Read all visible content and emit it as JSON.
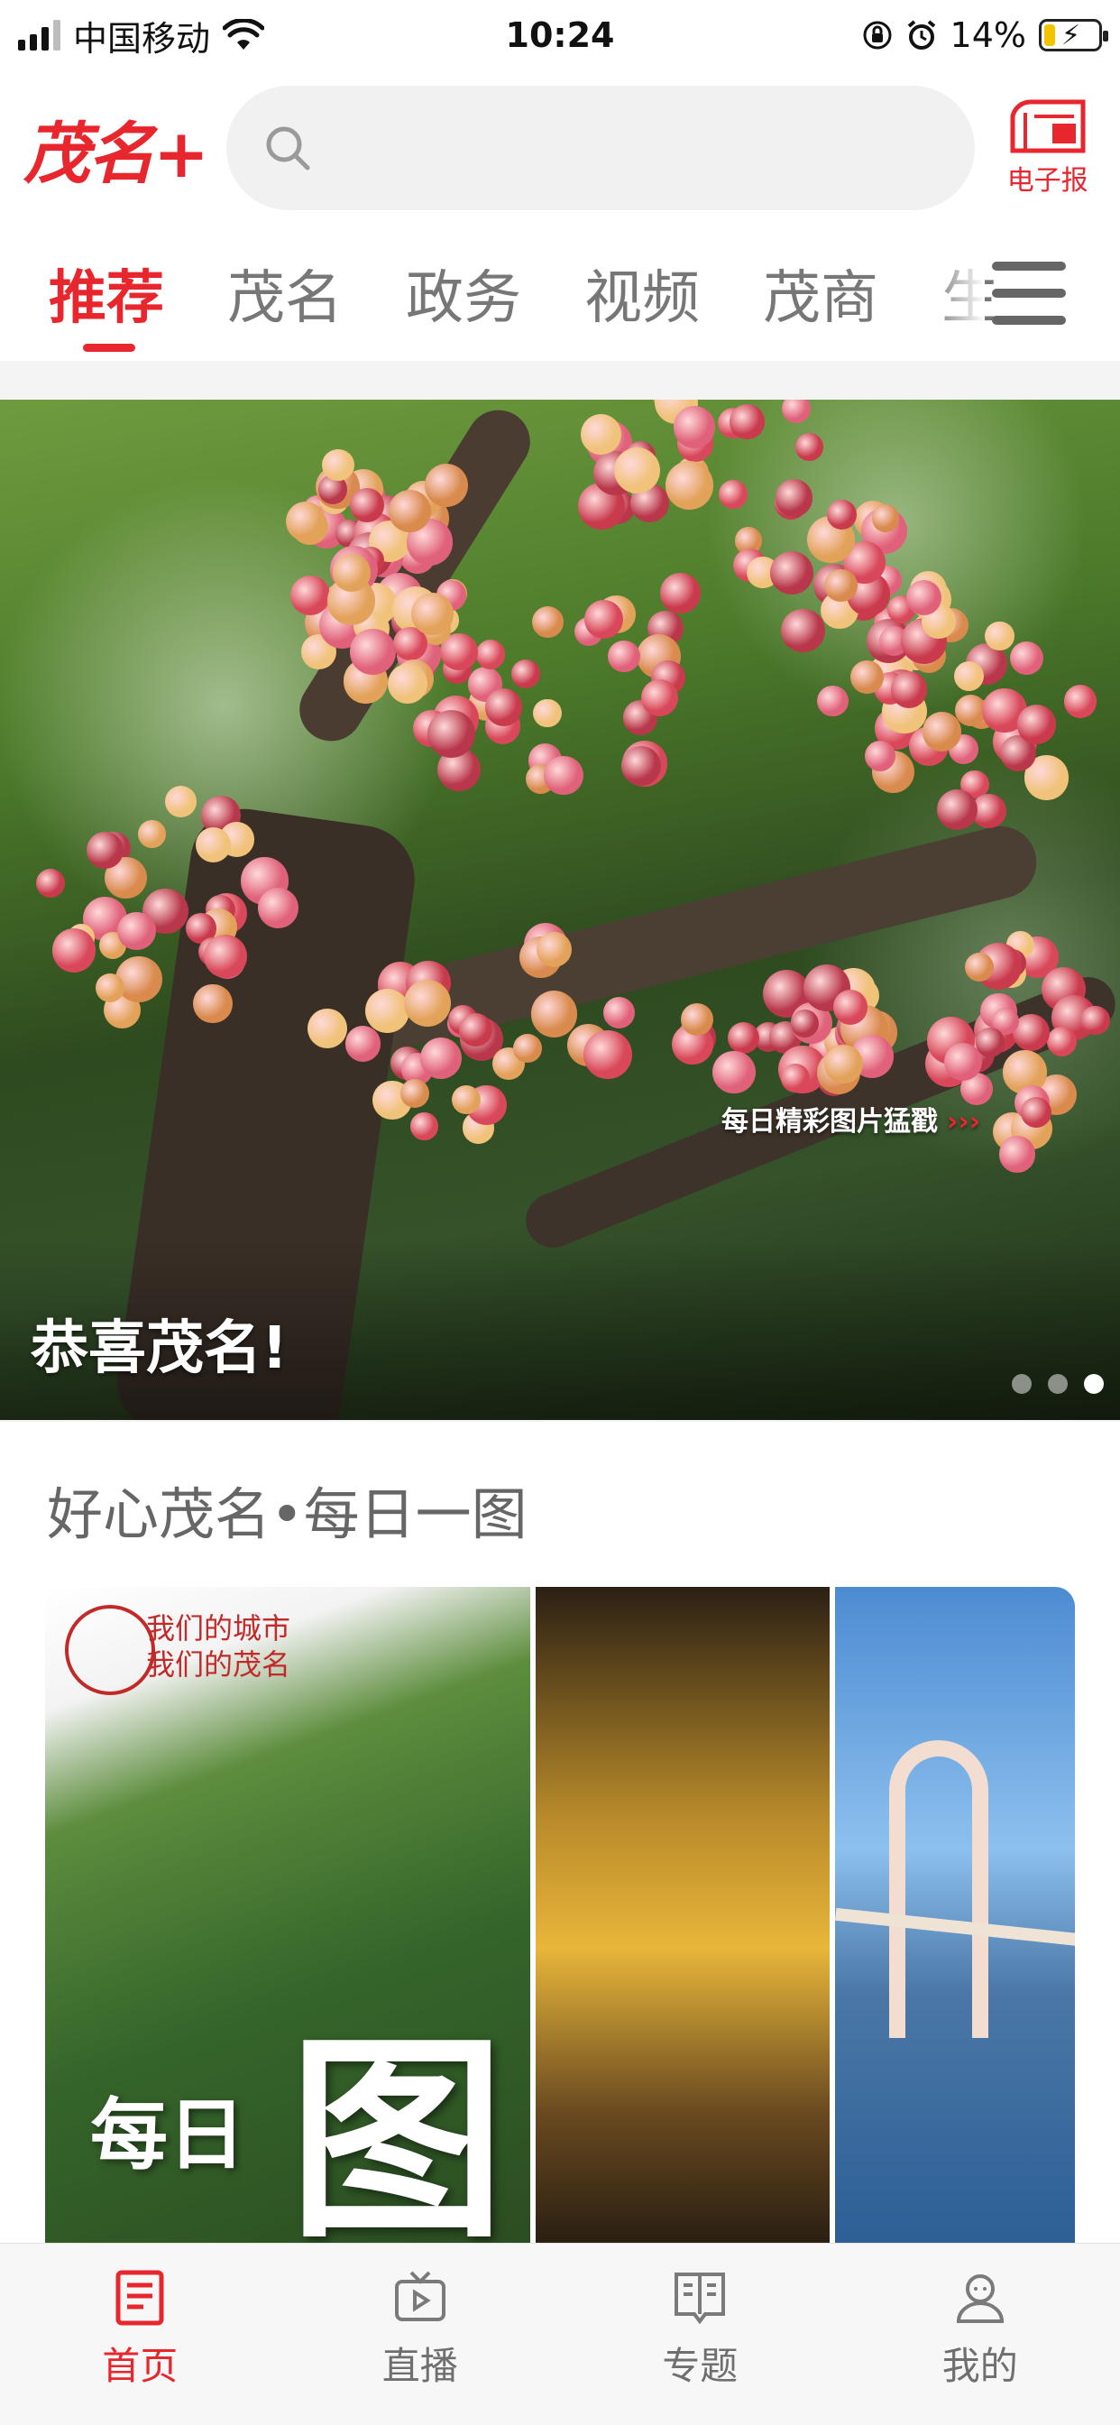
{
  "status_bar": {
    "carrier": "中国移动",
    "time": "10:24",
    "battery": "14%"
  },
  "header": {
    "logo": "茂名+",
    "search_placeholder": "",
    "epaper_label": "电子报"
  },
  "tabs": [
    {
      "label": "推荐",
      "active": true
    },
    {
      "label": "茂名",
      "active": false
    },
    {
      "label": "政务",
      "active": false
    },
    {
      "label": "视频",
      "active": false
    },
    {
      "label": "茂商",
      "active": false
    },
    {
      "label": "生",
      "active": false
    }
  ],
  "banner": {
    "caption": "恭喜茂名!",
    "slide_index": 3,
    "slide_count": 3
  },
  "daily_section": {
    "title": "好心茂名•每日一图",
    "image_slogan": "我们的城市\n我们的茂名",
    "image_big_char": "图",
    "image_small_chars": "每日",
    "image_footer": "每日精彩图片猛戳"
  },
  "bottom_nav": [
    {
      "label": "首页",
      "icon": "home-news-icon",
      "active": true
    },
    {
      "label": "直播",
      "icon": "tv-icon",
      "active": false
    },
    {
      "label": "专题",
      "icon": "book-icon",
      "active": false
    },
    {
      "label": "我的",
      "icon": "user-icon",
      "active": false
    }
  ],
  "colors": {
    "accent": "#e8262d",
    "inactive_text": "#777777"
  }
}
